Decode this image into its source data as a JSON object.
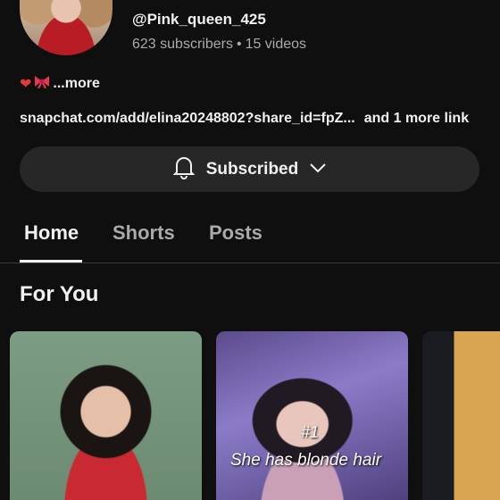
{
  "channel": {
    "handle": "@Pink_queen_425",
    "subscribers": "623 subscribers",
    "separator": "•",
    "videos": "15 videos",
    "description_more": "...more",
    "link_text": "snapchat.com/add/elina20248802?share_id=fpZ...",
    "more_links": "and 1 more link"
  },
  "subscribe_button": {
    "label": "Subscribed",
    "icon": "bell-icon",
    "dropdown_icon": "chevron-down-icon"
  },
  "tabs": [
    {
      "label": "Home",
      "active": true
    },
    {
      "label": "Shorts",
      "active": false
    },
    {
      "label": "Posts",
      "active": false
    }
  ],
  "section": {
    "title": "For You"
  },
  "thumbnails": [
    {
      "overlay_number": "",
      "overlay_text": ""
    },
    {
      "overlay_number": "#1",
      "overlay_text": "She has blonde hair"
    },
    {
      "overlay_number": "",
      "overlay_text": ""
    }
  ],
  "colors": {
    "background": "#0f0f0f",
    "button": "#272727",
    "text": "#f1f1f1",
    "muted": "#aaaaaa"
  }
}
